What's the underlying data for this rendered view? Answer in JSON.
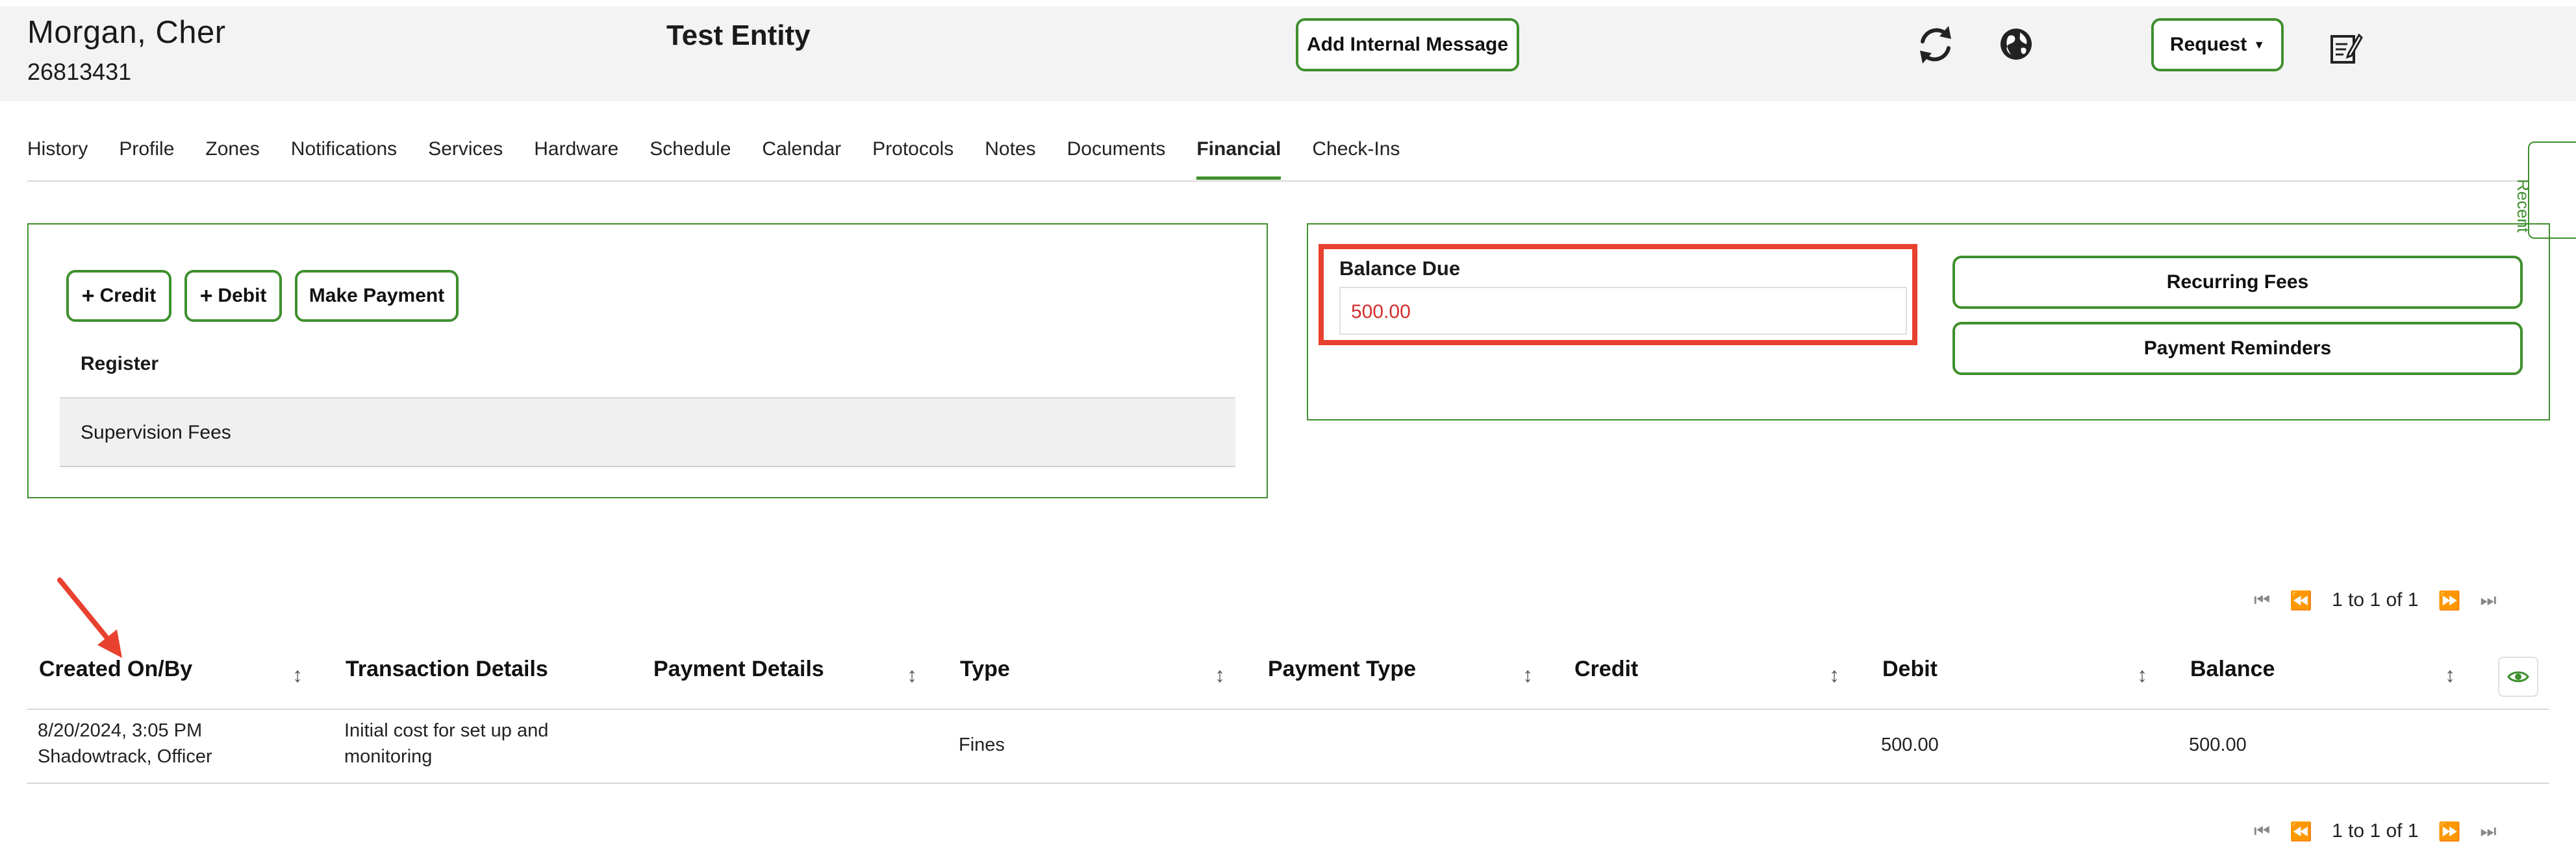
{
  "header": {
    "person_name": "Morgan, Cher",
    "person_id": "26813431",
    "entity": "Test Entity",
    "add_message_label": "Add Internal Message",
    "request_label": "Request",
    "refresh_icon": "refresh-icon",
    "globe_icon": "globe-icon",
    "notes_icon": "edit-notes-icon"
  },
  "tabs": [
    {
      "label": "History"
    },
    {
      "label": "Profile"
    },
    {
      "label": "Zones"
    },
    {
      "label": "Notifications"
    },
    {
      "label": "Services"
    },
    {
      "label": "Hardware"
    },
    {
      "label": "Schedule"
    },
    {
      "label": "Calendar"
    },
    {
      "label": "Protocols"
    },
    {
      "label": "Notes"
    },
    {
      "label": "Documents"
    },
    {
      "label": "Financial",
      "active": true
    },
    {
      "label": "Check-Ins"
    }
  ],
  "recent_label": "Recent",
  "left_panel": {
    "credit_label": "Credit",
    "debit_label": "Debit",
    "make_payment_label": "Make Payment",
    "register_label": "Register",
    "register_item": "Supervision Fees"
  },
  "right_panel": {
    "balance_due_label": "Balance Due",
    "balance_due_value": "500.00",
    "recurring_fees_label": "Recurring Fees",
    "payment_reminders_label": "Payment Reminders"
  },
  "pagination": {
    "text": "1 to 1 of 1"
  },
  "table": {
    "columns": [
      "Created On/By",
      "Transaction Details",
      "Payment Details",
      "Type",
      "Payment Type",
      "Credit",
      "Debit",
      "Balance"
    ],
    "rows": [
      {
        "created_on": "8/20/2024, 3:05 PM",
        "created_by": "Shadowtrack, Officer",
        "transaction_details_1": "Initial cost for set up and",
        "transaction_details_2": "monitoring",
        "payment_details": "",
        "type": "Fines",
        "payment_type": "",
        "credit": "",
        "debit": "500.00",
        "balance": "500.00"
      }
    ]
  },
  "colors": {
    "accent_green": "#3f8f2e",
    "highlight_red": "#e8412f",
    "balance_red": "#d32f2f"
  }
}
